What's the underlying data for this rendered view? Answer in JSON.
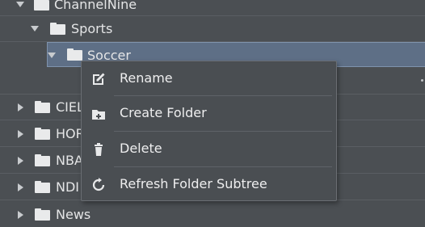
{
  "tree": {
    "nodes": [
      {
        "label": "ChannelNine",
        "expanded": true
      },
      {
        "label": "Sports",
        "expanded": true
      },
      {
        "label": "Soccer",
        "expanded": true,
        "selected": true
      },
      {
        "label": "CIEL",
        "expanded": false
      },
      {
        "label": "HOR",
        "expanded": false
      },
      {
        "label": "NBA",
        "expanded": false
      },
      {
        "label": "NDI",
        "expanded": false
      },
      {
        "label": "News",
        "expanded": false
      }
    ]
  },
  "context_menu": {
    "items": [
      {
        "label": "Rename",
        "icon": "edit-icon"
      },
      {
        "label": "Create Folder",
        "icon": "folder-plus-icon"
      },
      {
        "label": "Delete",
        "icon": "trash-icon"
      },
      {
        "label": "Refresh Folder Subtree",
        "icon": "refresh-icon"
      }
    ]
  }
}
